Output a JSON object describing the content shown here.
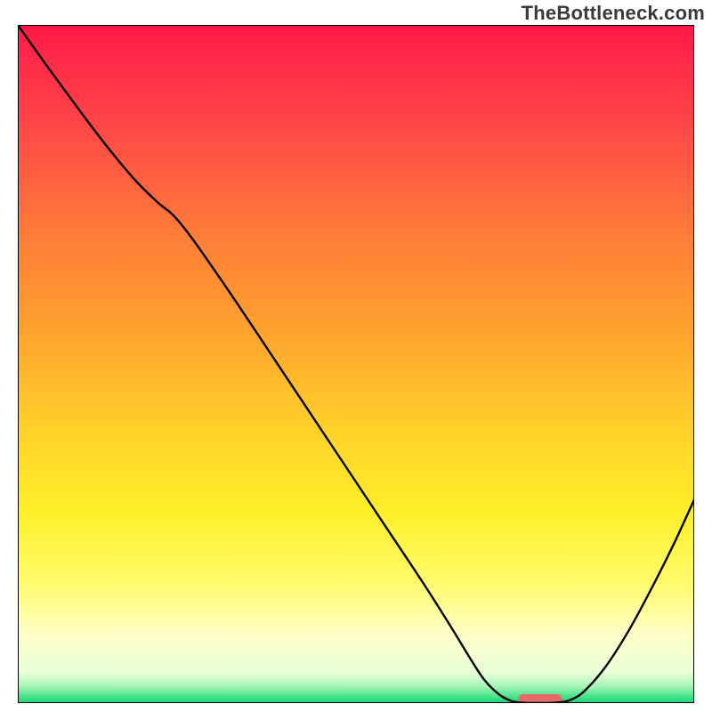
{
  "watermark": "TheBottleneck.com",
  "chart_data": {
    "type": "line",
    "title": "",
    "xlabel": "",
    "ylabel": "",
    "x_range": [
      0,
      100
    ],
    "y_range": [
      0,
      100
    ],
    "note": "Axes are implicit / unlabeled; values are estimated percentages of plot width/height read from the curve.",
    "gradient_stops": [
      {
        "offset": 0,
        "color": "#ff1744"
      },
      {
        "offset": 0.05,
        "color": "#ff2a4a"
      },
      {
        "offset": 0.15,
        "color": "#ff4747"
      },
      {
        "offset": 0.3,
        "color": "#ff7a3a"
      },
      {
        "offset": 0.45,
        "color": "#ffa22e"
      },
      {
        "offset": 0.6,
        "color": "#ffd22a"
      },
      {
        "offset": 0.72,
        "color": "#fff02a"
      },
      {
        "offset": 0.82,
        "color": "#fffb6a"
      },
      {
        "offset": 0.9,
        "color": "#ffffc8"
      },
      {
        "offset": 0.955,
        "color": "#e8ffd8"
      },
      {
        "offset": 0.975,
        "color": "#a8f5b8"
      },
      {
        "offset": 0.99,
        "color": "#4ae38a"
      },
      {
        "offset": 1.0,
        "color": "#17d477"
      }
    ],
    "series": [
      {
        "name": "bottleneck-curve",
        "stroke": "#000000",
        "points_xy_percent": [
          [
            0.0,
            100.0
          ],
          [
            5.0,
            93.0
          ],
          [
            12.0,
            83.6
          ],
          [
            17.0,
            77.5
          ],
          [
            20.5,
            74.0
          ],
          [
            24.0,
            70.8
          ],
          [
            30.0,
            62.5
          ],
          [
            38.0,
            50.6
          ],
          [
            46.0,
            38.6
          ],
          [
            54.0,
            26.6
          ],
          [
            60.0,
            17.6
          ],
          [
            64.0,
            11.3
          ],
          [
            67.0,
            6.4
          ],
          [
            69.0,
            3.4
          ],
          [
            71.0,
            1.4
          ],
          [
            72.5,
            0.5
          ],
          [
            74.0,
            0.1
          ],
          [
            77.0,
            0.0
          ],
          [
            80.0,
            0.1
          ],
          [
            82.0,
            0.6
          ],
          [
            84.0,
            2.0
          ],
          [
            87.0,
            5.5
          ],
          [
            90.5,
            11.0
          ],
          [
            94.0,
            17.5
          ],
          [
            97.0,
            23.5
          ],
          [
            100.0,
            30.0
          ]
        ]
      }
    ],
    "marker": {
      "name": "optimal-range-marker",
      "color": "#e46a6a",
      "x_percent_start": 74.0,
      "x_percent_end": 80.5,
      "y_percent": 0.0,
      "height_percent": 1.6
    },
    "frame_stroke": "#000000"
  }
}
